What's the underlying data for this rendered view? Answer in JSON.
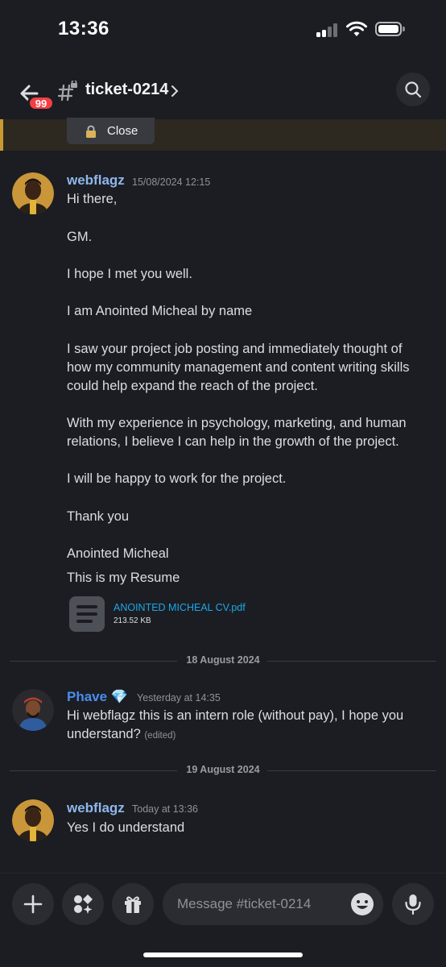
{
  "status_bar": {
    "time": "13:36"
  },
  "header": {
    "unread_badge": "99",
    "channel_name": "ticket-0214"
  },
  "pinned": {
    "close_label": "Close"
  },
  "messages": [
    {
      "author": "webflagz",
      "timestamp": "15/08/2024 12:15",
      "lines": [
        "Hi there,",
        "GM.",
        "I hope I met you well.",
        "I am Anointed Micheal by name",
        "I saw your project job posting and immediately thought of",
        "how my community management and content writing skills",
        "could help expand the reach of the project.",
        "With my experience in psychology, marketing, and human",
        "relations, I believe I can help in the growth of the project.",
        "I will be happy to work for the project.",
        "Thank you",
        "Anointed Micheal",
        "This is my Resume"
      ],
      "attachment": {
        "name": "ANOINTED MICHEAL CV.pdf",
        "size": "213.52 KB"
      }
    },
    {
      "author": "Phave",
      "author_emoji": "💎",
      "timestamp": "Yesterday at 14:35",
      "lines": [
        "Hi webflagz this is an intern role (without pay), I hope you",
        "understand?"
      ],
      "edited_label": "(edited)"
    },
    {
      "author": "webflagz",
      "timestamp": "Today at 13:36",
      "lines": [
        "Yes I do understand"
      ]
    }
  ],
  "dividers": [
    "18 August 2024",
    "19 August 2024"
  ],
  "composer": {
    "placeholder": "Message #ticket-0214"
  },
  "colors": {
    "accent_blue": "#4a8df0",
    "username_blue": "#8fb7ec",
    "badge_red": "#f23f43",
    "link_blue": "#1aa8ea"
  }
}
